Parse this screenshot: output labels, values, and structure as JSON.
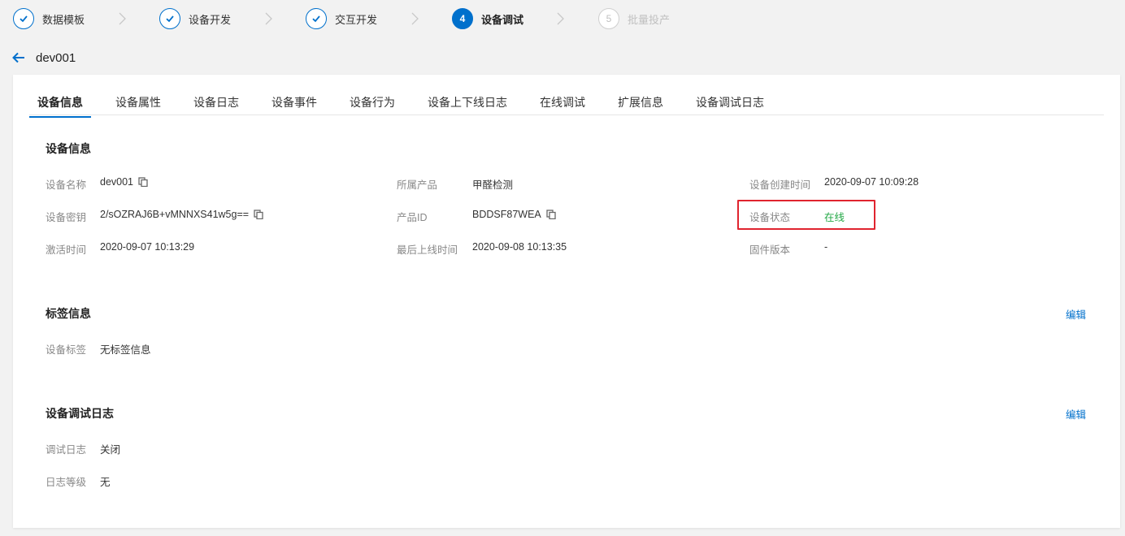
{
  "steps": [
    {
      "label": "数据模板",
      "state": "done"
    },
    {
      "label": "设备开发",
      "state": "done"
    },
    {
      "label": "交互开发",
      "state": "done"
    },
    {
      "label": "设备调试",
      "number": "4",
      "state": "active"
    },
    {
      "label": "批量投产",
      "number": "5",
      "state": "pending"
    }
  ],
  "header": {
    "title": "dev001"
  },
  "tabs": [
    "设备信息",
    "设备属性",
    "设备日志",
    "设备事件",
    "设备行为",
    "设备上下线日志",
    "在线调试",
    "扩展信息",
    "设备调试日志"
  ],
  "device_info": {
    "title": "设备信息",
    "name_label": "设备名称",
    "name_value": "dev001",
    "product_label": "所属产品",
    "product_value": "甲醛检测",
    "created_label": "设备创建时间",
    "created_value": "2020-09-07 10:09:28",
    "secret_label": "设备密钥",
    "secret_value": "2/sOZRAJ6B+vMNNXS41w5g==",
    "pid_label": "产品ID",
    "pid_value": "BDDSF87WEA",
    "status_label": "设备状态",
    "status_value": "在线",
    "activated_label": "激活时间",
    "activated_value": "2020-09-07 10:13:29",
    "last_online_label": "最后上线时间",
    "last_online_value": "2020-09-08 10:13:35",
    "firmware_label": "固件版本",
    "firmware_value": "-"
  },
  "tag_info": {
    "title": "标签信息",
    "edit": "编辑",
    "tag_label": "设备标签",
    "tag_value": "无标签信息"
  },
  "debug_log": {
    "title": "设备调试日志",
    "edit": "编辑",
    "log_label": "调试日志",
    "log_value": "关闭",
    "level_label": "日志等级",
    "level_value": "无"
  },
  "colors": {
    "accent": "#0070cc",
    "online": "#22a845",
    "highlight": "#e0242f"
  }
}
